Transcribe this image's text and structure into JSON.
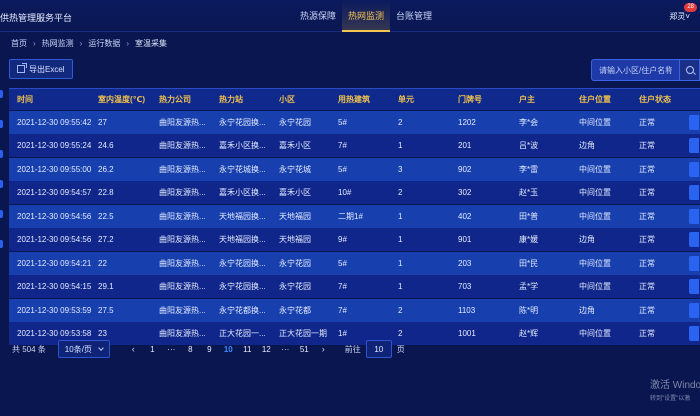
{
  "header": {
    "app_title": "供热管理服务平台",
    "nav": [
      {
        "label": "热源保障",
        "active": false
      },
      {
        "label": "热网监测",
        "active": true
      },
      {
        "label": "台账管理",
        "active": false
      }
    ],
    "user_name": "郑灵",
    "badge_count": "28"
  },
  "breadcrumb": [
    "首页",
    "热网监测",
    "运行数据",
    "室温采集"
  ],
  "toolbar": {
    "export_label": "导出Excel",
    "search_placeholder": "请输入小区/住户名称"
  },
  "table": {
    "headers": [
      "时间",
      "室内温度(℃)",
      "热力公司",
      "热力站",
      "小区",
      "用热建筑",
      "单元",
      "门牌号",
      "户主",
      "住户位置",
      "住户状态"
    ],
    "rows": [
      [
        "2021-12-30 09:55:42",
        "27",
        "曲阳友源热...",
        "永宁花园换...",
        "永宁花园",
        "5#",
        "2",
        "1202",
        "李*会",
        "中间位置",
        "正常"
      ],
      [
        "2021-12-30 09:55:24",
        "24.6",
        "曲阳友源热...",
        "嘉禾小区换...",
        "嘉禾小区",
        "7#",
        "1",
        "201",
        "吕*波",
        "边角",
        "正常"
      ],
      [
        "2021-12-30 09:55:00",
        "26.2",
        "曲阳友源热...",
        "永宁花城换...",
        "永宁花城",
        "5#",
        "3",
        "902",
        "李*雷",
        "中间位置",
        "正常"
      ],
      [
        "2021-12-30 09:54:57",
        "22.8",
        "曲阳友源热...",
        "嘉禾小区换...",
        "嘉禾小区",
        "10#",
        "2",
        "302",
        "赵*玉",
        "中间位置",
        "正常"
      ],
      [
        "2021-12-30 09:54:56",
        "22.5",
        "曲阳友源热...",
        "天地福园换...",
        "天地福园",
        "二期1#",
        "1",
        "402",
        "田*普",
        "中间位置",
        "正常"
      ],
      [
        "2021-12-30 09:54:56",
        "27.2",
        "曲阳友源热...",
        "天地福园换...",
        "天地福园",
        "9#",
        "1",
        "901",
        "康*媛",
        "边角",
        "正常"
      ],
      [
        "2021-12-30 09:54:21",
        "22",
        "曲阳友源热...",
        "永宁花园换...",
        "永宁花园",
        "5#",
        "1",
        "203",
        "田*民",
        "中间位置",
        "正常"
      ],
      [
        "2021-12-30 09:54:15",
        "29.1",
        "曲阳友源热...",
        "永宁花园换...",
        "永宁花园",
        "7#",
        "1",
        "703",
        "孟*学",
        "中间位置",
        "正常"
      ],
      [
        "2021-12-30 09:53:59",
        "27.5",
        "曲阳友源热...",
        "永宁花都换...",
        "永宁花都",
        "7#",
        "2",
        "1103",
        "陈*明",
        "边角",
        "正常"
      ],
      [
        "2021-12-30 09:53:58",
        "23",
        "曲阳友源热...",
        "正大花园一...",
        "正大花园一期",
        "1#",
        "2",
        "1001",
        "赵*辉",
        "中间位置",
        "正常"
      ]
    ]
  },
  "pagination": {
    "total_text": "共 504 条",
    "page_size": "10条/页",
    "pages": [
      "1",
      "···",
      "8",
      "9",
      "10",
      "11",
      "12",
      "···",
      "51"
    ],
    "current_page": "10",
    "goto_label": "前往",
    "goto_value": "10",
    "goto_unit": "页"
  },
  "watermark": {
    "line1": "激活 Windo",
    "line2": "转到\"设置\"以激"
  },
  "colors": {
    "background": "#0a1650",
    "header_accent": "#f5c451",
    "table_header_text": "#f2c24e",
    "row_odd": "#173fae",
    "row_even": "#10268a",
    "active_page": "#3f8cff"
  }
}
